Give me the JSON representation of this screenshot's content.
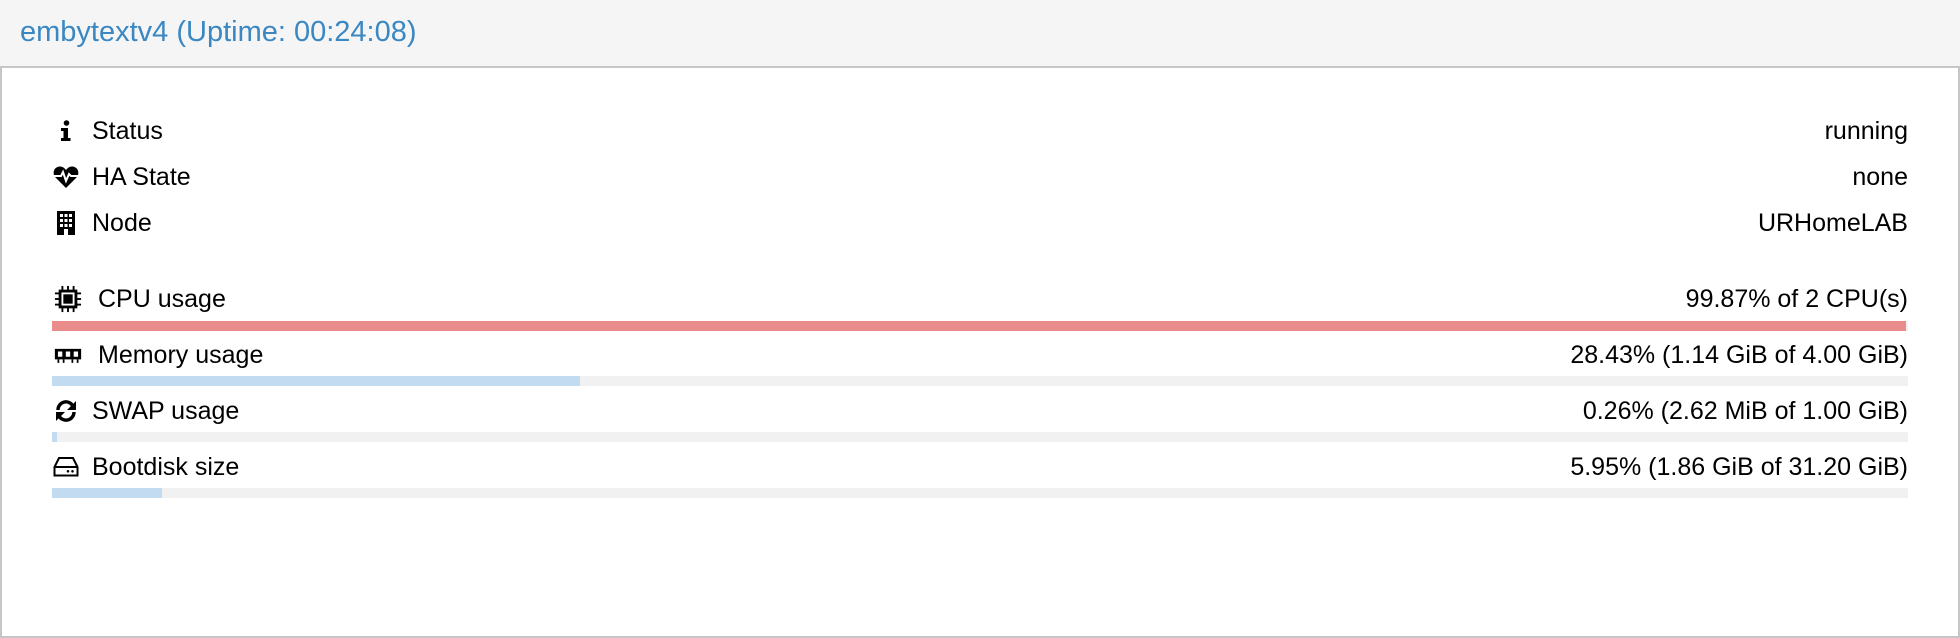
{
  "header": {
    "title": "embytextv4 (Uptime: 00:24:08)"
  },
  "colors": {
    "title": "#3a87c1",
    "bar_track": "#f1f1f1",
    "bar_normal": "#c2dbf0",
    "bar_critical": "#ea8c8c"
  },
  "info": [
    {
      "icon": "info-icon",
      "label": "Status",
      "value": "running"
    },
    {
      "icon": "heartbeat-icon",
      "label": "HA State",
      "value": "none"
    },
    {
      "icon": "building-icon",
      "label": "Node",
      "value": "URHomeLAB"
    }
  ],
  "usage": [
    {
      "icon": "cpu-chip-icon",
      "label": "CPU usage",
      "value": "99.87% of 2 CPU(s)",
      "fraction": 0.9987,
      "level": "critical"
    },
    {
      "icon": "memory-icon",
      "label": "Memory usage",
      "value": "28.43% (1.14 GiB of 4.00 GiB)",
      "fraction": 0.2843,
      "level": "normal"
    },
    {
      "icon": "refresh-icon",
      "label": "SWAP usage",
      "value": "0.26% (2.62 MiB of 1.00 GiB)",
      "fraction": 0.0026,
      "level": "normal"
    },
    {
      "icon": "hdd-icon",
      "label": "Bootdisk size",
      "value": "5.95% (1.86 GiB of 31.20 GiB)",
      "fraction": 0.0595,
      "level": "normal"
    }
  ]
}
